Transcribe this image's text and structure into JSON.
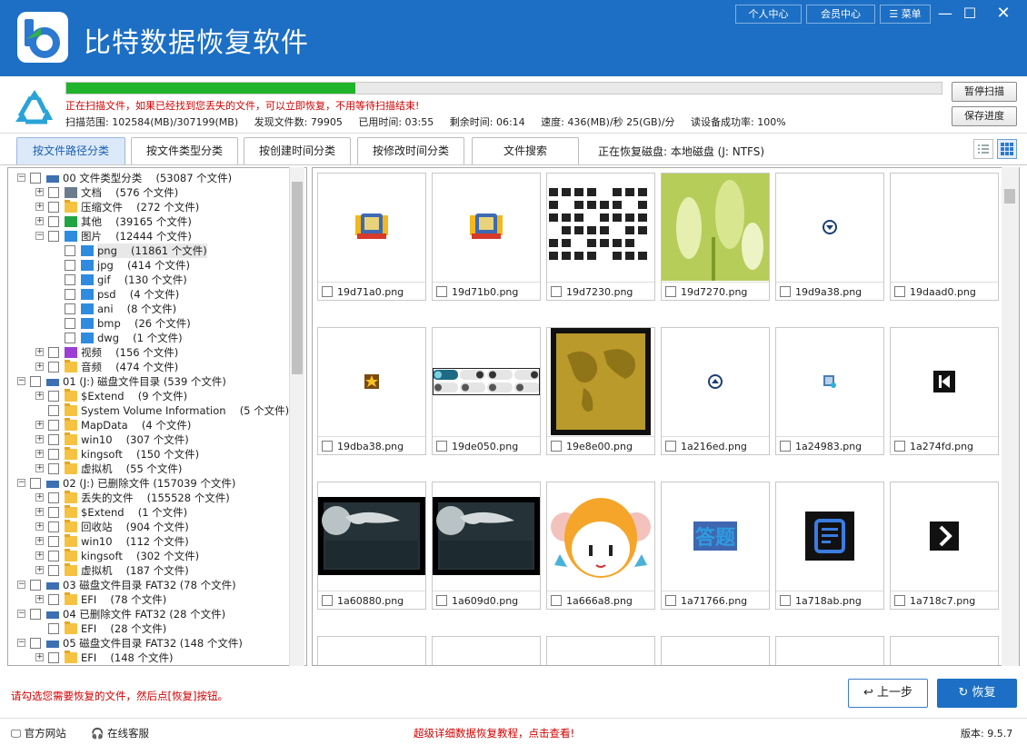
{
  "app": {
    "title": "比特数据恢复软件",
    "brand_color": "#1c6fc4"
  },
  "topbar": {
    "personal_center": "个人中心",
    "member_center": "会员中心",
    "menu": "菜单"
  },
  "scan": {
    "progress_fraction": 0.33,
    "message": "正在扫描文件，如果已经找到您丢失的文件，可以立即恢复，不用等待扫描结束!",
    "range_label": "扫描范围: 102584(MB)/307199(MB)",
    "found_label": "发现文件数: 79905",
    "elapsed_label": "已用时间: 03:55",
    "remaining_label": "剩余时间: 06:14",
    "speed_label": "速度: 436(MB)/秒  25(GB)/分",
    "read_success_label": "读设备成功率: 100%",
    "pause_button": "暂停扫描",
    "save_button": "保存进度"
  },
  "tabs": [
    {
      "label": "按文件路径分类",
      "active": true
    },
    {
      "label": "按文件类型分类",
      "active": false
    },
    {
      "label": "按创建时间分类",
      "active": false
    },
    {
      "label": "按修改时间分类",
      "active": false
    },
    {
      "label": "文件搜索",
      "active": false
    }
  ],
  "disk_info": "正在恢复磁盘: 本地磁盘 (J: NTFS)",
  "tree": [
    {
      "label": "00 文件类型分类 　(53087 个文件)",
      "level": 0,
      "icon": "drive",
      "expanded": true
    },
    {
      "label": "文档 　(576 个文件)",
      "level": 1,
      "icon": "gray",
      "expanded": false
    },
    {
      "label": "压缩文件 　(272 个文件)",
      "level": 1,
      "icon": "folder",
      "expanded": false
    },
    {
      "label": "其他 　(39165 个文件)",
      "level": 1,
      "icon": "green",
      "expanded": false
    },
    {
      "label": "图片 　(12444 个文件)",
      "level": 1,
      "icon": "pic",
      "expanded": true
    },
    {
      "label": "png 　(11861 个文件)",
      "level": 2,
      "icon": "pic",
      "selected": true
    },
    {
      "label": "jpg 　(414 个文件)",
      "level": 2,
      "icon": "pic"
    },
    {
      "label": "gif 　(130 个文件)",
      "level": 2,
      "icon": "pic"
    },
    {
      "label": "psd 　(4 个文件)",
      "level": 2,
      "icon": "pic"
    },
    {
      "label": "ani 　(8 个文件)",
      "level": 2,
      "icon": "pic"
    },
    {
      "label": "bmp 　(26 个文件)",
      "level": 2,
      "icon": "pic"
    },
    {
      "label": "dwg 　(1 个文件)",
      "level": 2,
      "icon": "pic"
    },
    {
      "label": "视频 　(156 个文件)",
      "level": 1,
      "icon": "purple",
      "expanded": false
    },
    {
      "label": "音频 　(474 个文件)",
      "level": 1,
      "icon": "folder",
      "expanded": false
    },
    {
      "label": "01 (J:) 磁盘文件目录 (539 个文件)",
      "level": 0,
      "icon": "drive",
      "expanded": true
    },
    {
      "label": "$Extend 　(9 个文件)",
      "level": 1,
      "icon": "folder",
      "expanded": false
    },
    {
      "label": "System Volume Information 　(5 个文件)",
      "level": 1,
      "icon": "folder"
    },
    {
      "label": "MapData 　(4 个文件)",
      "level": 1,
      "icon": "folder",
      "expanded": false
    },
    {
      "label": "win10 　(307 个文件)",
      "level": 1,
      "icon": "folder",
      "expanded": false
    },
    {
      "label": "kingsoft 　(150 个文件)",
      "level": 1,
      "icon": "folder",
      "expanded": false
    },
    {
      "label": "虚拟机 　(55 个文件)",
      "level": 1,
      "icon": "folder",
      "expanded": false
    },
    {
      "label": "02 (J:) 已删除文件 (157039 个文件)",
      "level": 0,
      "icon": "drive",
      "expanded": true
    },
    {
      "label": "丢失的文件 　(155528 个文件)",
      "level": 1,
      "icon": "folder",
      "expanded": false
    },
    {
      "label": "$Extend 　(1 个文件)",
      "level": 1,
      "icon": "folder",
      "expanded": false
    },
    {
      "label": "回收站 　(904 个文件)",
      "level": 1,
      "icon": "folder",
      "expanded": false
    },
    {
      "label": "win10 　(112 个文件)",
      "level": 1,
      "icon": "folder",
      "expanded": false
    },
    {
      "label": "kingsoft 　(302 个文件)",
      "level": 1,
      "icon": "folder",
      "expanded": false
    },
    {
      "label": "虚拟机 　(187 个文件)",
      "level": 1,
      "icon": "folder",
      "expanded": false
    },
    {
      "label": "03 磁盘文件目录 FAT32 (78 个文件)",
      "level": 0,
      "icon": "drive",
      "expanded": true
    },
    {
      "label": "EFI 　(78 个文件)",
      "level": 1,
      "icon": "folder",
      "expanded": false
    },
    {
      "label": "04 已删除文件 FAT32 (28 个文件)",
      "level": 0,
      "icon": "drive",
      "expanded": true
    },
    {
      "label": "EFI 　(28 个文件)",
      "level": 1,
      "icon": "folder"
    },
    {
      "label": "05 磁盘文件目录 FAT32 (148 个文件)",
      "level": 0,
      "icon": "drive",
      "expanded": true
    },
    {
      "label": "EFI 　(148 个文件)",
      "level": 1,
      "icon": "folder",
      "expanded": false
    }
  ],
  "files": [
    {
      "name": "19d71a0.png",
      "thumb": "badge-orange"
    },
    {
      "name": "19d71b0.png",
      "thumb": "badge-orange-n7"
    },
    {
      "name": "19d7230.png",
      "thumb": "icon-sheet"
    },
    {
      "name": "19d7270.png",
      "thumb": "grass-photo"
    },
    {
      "name": "19d9a38.png",
      "thumb": "circle-down-icon"
    },
    {
      "name": "19daad0.png",
      "thumb": "blank"
    },
    {
      "name": "19dba38.png",
      "thumb": "star-icon"
    },
    {
      "name": "19de050.png",
      "thumb": "toggle-sprites"
    },
    {
      "name": "19e8e00.png",
      "thumb": "gold-map"
    },
    {
      "name": "1a216ed.png",
      "thumb": "circle-up-icon"
    },
    {
      "name": "1a24983.png",
      "thumb": "small-app-icon"
    },
    {
      "name": "1a274fd.png",
      "thumb": "skip-back-icon"
    },
    {
      "name": "1a60880.png",
      "thumb": "moon-dark"
    },
    {
      "name": "1a609d0.png",
      "thumb": "moon-dark"
    },
    {
      "name": "1a666a8.png",
      "thumb": "cartoon-girl"
    },
    {
      "name": "1a71766.png",
      "thumb": "answer-text"
    },
    {
      "name": "1a718ab.png",
      "thumb": "document-icon"
    },
    {
      "name": "1a718c7.png",
      "thumb": "chevron-right-icon"
    }
  ],
  "answer_text": "答题",
  "hint": "请勾选您需要恢复的文件，然后点[恢复]按钮。",
  "prev_button": "上一步",
  "recover_button": "恢复",
  "footer": {
    "website": "官方网站",
    "support": "在线客服",
    "tutorial": "超级详细数据恢复教程，点击查看!",
    "version": "版本: 9.5.7"
  }
}
